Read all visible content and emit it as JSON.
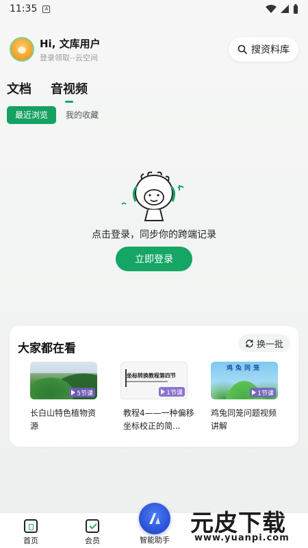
{
  "status_bar": {
    "time": "11:35",
    "sim_label": "A"
  },
  "header": {
    "greeting": "Hi, 文库用户",
    "subtitle": "登录领取--云空间",
    "search_label": "搜资料库"
  },
  "main_tabs": [
    {
      "label": "文档",
      "active": false
    },
    {
      "label": "音视频",
      "active": true
    }
  ],
  "sub_tabs": [
    {
      "label": "最近浏览",
      "active": true
    },
    {
      "label": "我的收藏",
      "active": false
    }
  ],
  "empty_state": {
    "message": "点击登录，同步你的跨端记录",
    "login_button": "立即登录"
  },
  "recommend": {
    "title": "大家都在看",
    "refresh_label": "换一批",
    "items": [
      {
        "title": "长白山特色植物资源",
        "badge": "5节课",
        "thumb": "mountain"
      },
      {
        "title": "教程4——一种偏移坐标校正的简...",
        "badge": "1节课",
        "thumb": "doc",
        "thumb_text": "坐标转换教程第四节"
      },
      {
        "title": "鸡兔同笼问题视频讲解",
        "badge": "1节课",
        "thumb": "cartoon",
        "thumb_text": "鸡兔同笼"
      }
    ]
  },
  "bottom_nav": {
    "items": [
      {
        "label": "首页",
        "icon": "home-icon"
      },
      {
        "label": "会员",
        "icon": "vip-icon"
      }
    ],
    "assistant_label": "智能助手"
  },
  "watermark": {
    "main": "元皮下载",
    "url": "www.yuanpi.com"
  },
  "colors": {
    "accent": "#15a565",
    "assistant": "#2c56d8",
    "badge": "#7a5ac8"
  }
}
